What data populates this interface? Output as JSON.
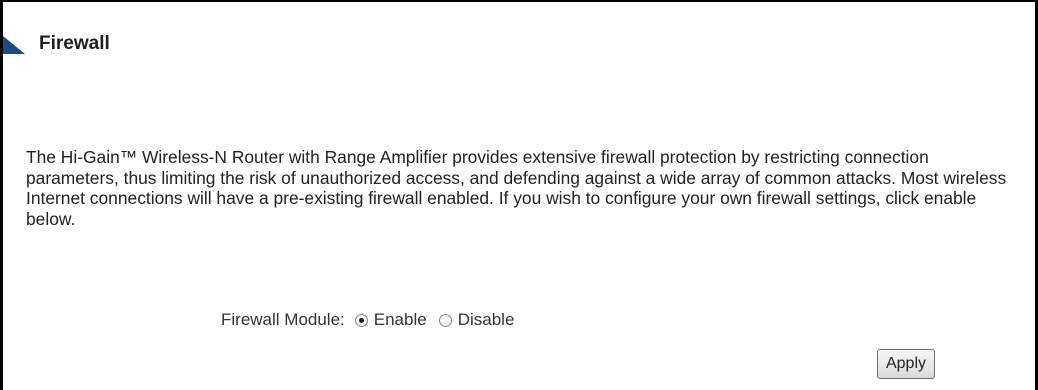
{
  "page": {
    "title": "Firewall",
    "description": "The Hi-Gain™ Wireless-N Router with Range Amplifier provides extensive firewall protection by restricting connection parameters, thus limiting the risk of unauthorized access, and defending against a wide array of common attacks. Most wireless Internet connections will have a pre-existing firewall enabled. If you wish to configure your own firewall settings, click enable below."
  },
  "firewall_module": {
    "label": "Firewall Module:",
    "options": [
      {
        "label": "Enable",
        "selected": true
      },
      {
        "label": "Disable",
        "selected": false
      }
    ]
  },
  "actions": {
    "apply_label": "Apply"
  },
  "colors": {
    "title_marker": "#1a4c7e",
    "frame_border": "#000000"
  },
  "icons": {
    "title_marker": "triangle-marker-icon"
  }
}
